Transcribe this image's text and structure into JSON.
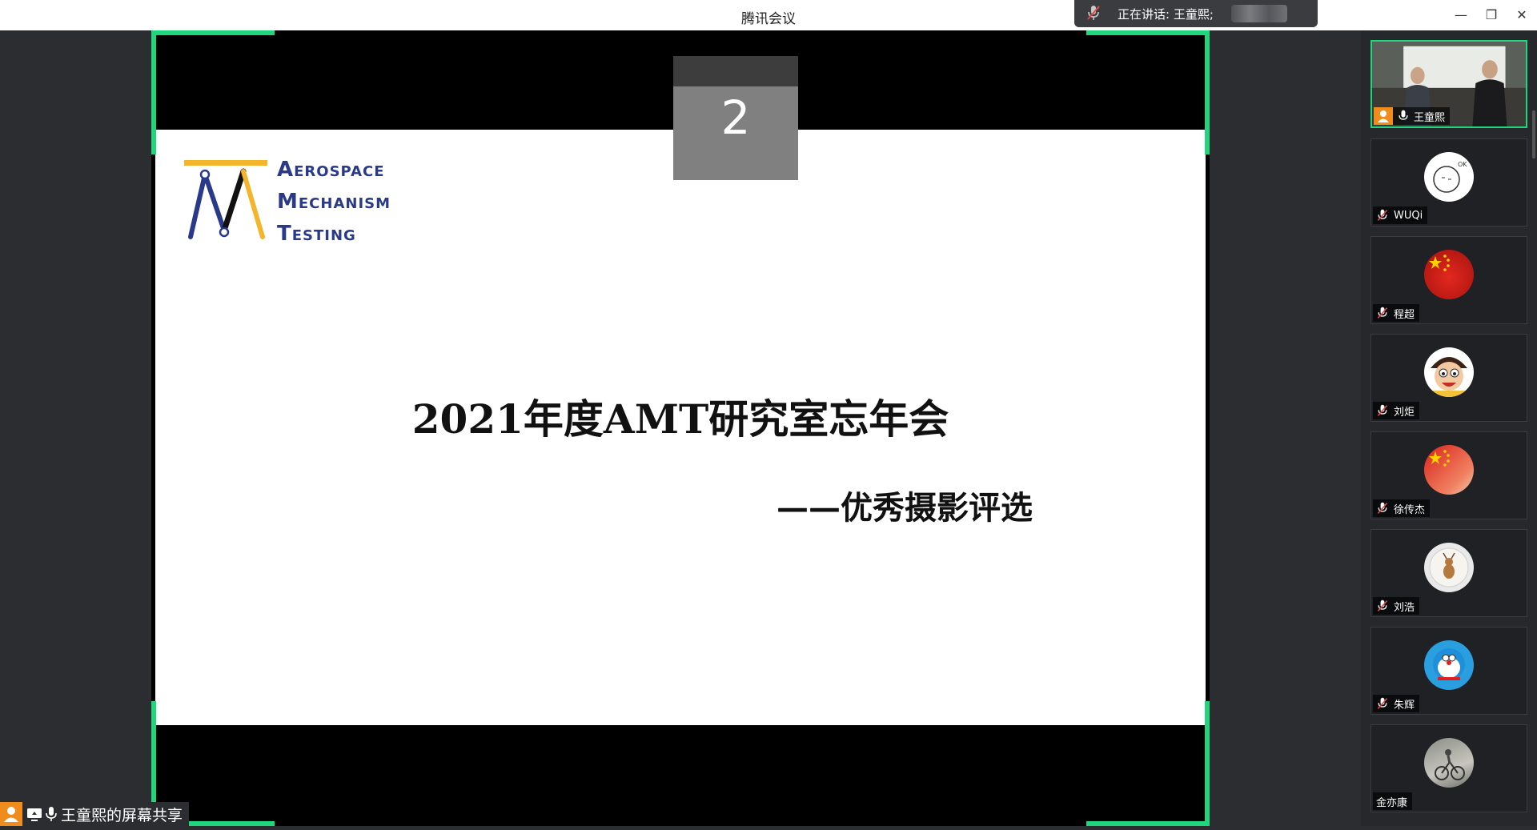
{
  "window": {
    "title": "腾讯会议",
    "minimize": "—",
    "restore": "❐",
    "close": "✕"
  },
  "speaking": {
    "label": "正在讲话: 王童熙;"
  },
  "slide": {
    "page_number": "2",
    "brand_lines": [
      "Aerospace",
      "Mechanism",
      "Testing"
    ],
    "title": "2021年度AMT研究室忘年会",
    "subtitle": "——优秀摄影评选"
  },
  "share_label": "王童熙的屏幕共享",
  "participants": [
    {
      "name": "王童熙",
      "mic": "on",
      "video": true
    },
    {
      "name": "WUQi",
      "mic": "muted",
      "avatar": "doodle-face"
    },
    {
      "name": "程超",
      "mic": "muted",
      "avatar": "china-flag"
    },
    {
      "name": "刘炬",
      "mic": "muted",
      "avatar": "cartoon-boy"
    },
    {
      "name": "徐传杰",
      "mic": "muted",
      "avatar": "china-flag"
    },
    {
      "name": "刘浩",
      "mic": "muted",
      "avatar": "deer"
    },
    {
      "name": "朱辉",
      "mic": "muted",
      "avatar": "doraemon"
    },
    {
      "name": "金亦康",
      "mic": "none",
      "avatar": "cyclist-photo"
    }
  ],
  "colors": {
    "accent_green": "#1fd67c",
    "brand_blue": "#2a3a8a",
    "logo_yellow": "#f2b52b",
    "orange": "#f08c1c"
  }
}
